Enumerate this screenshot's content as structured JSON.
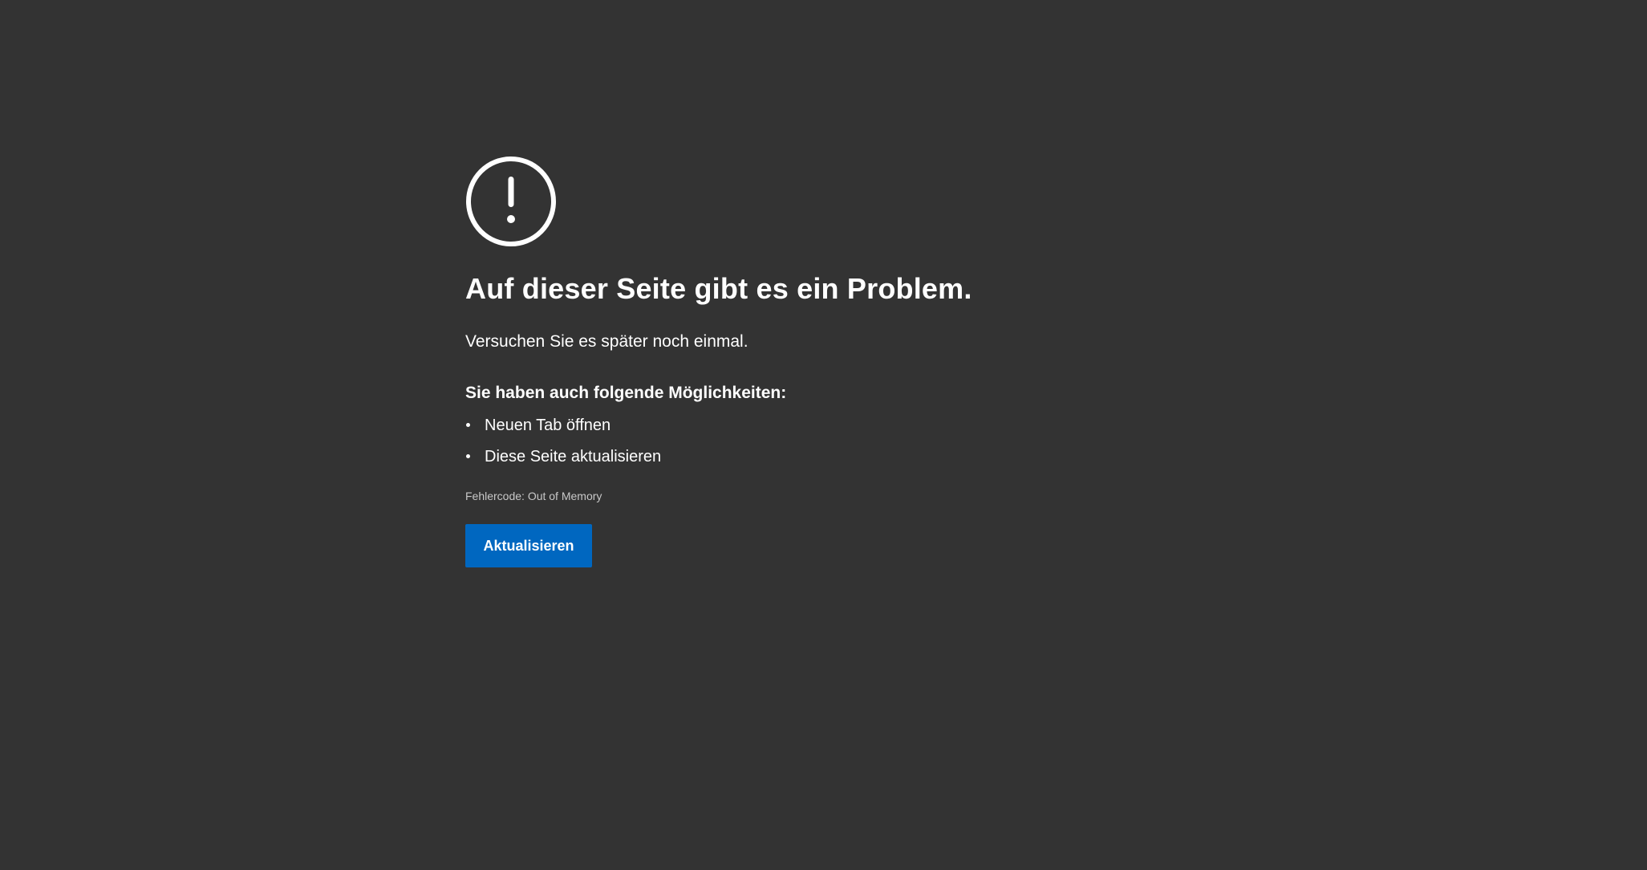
{
  "error": {
    "icon": "exclamation-circle-icon",
    "title": "Auf dieser Seite gibt es ein Problem.",
    "message": "Versuchen Sie es später noch einmal.",
    "options_heading": "Sie haben auch folgende Möglichkeiten:",
    "options": [
      {
        "label": "Neuen Tab öffnen"
      },
      {
        "label": "Diese Seite aktualisieren"
      }
    ],
    "error_code": "Fehlercode: Out of Memory",
    "button_label": "Aktualisieren"
  },
  "colors": {
    "background": "#333333",
    "text": "#ffffff",
    "muted_text": "#c8c8c8",
    "button": "#0067c0"
  }
}
